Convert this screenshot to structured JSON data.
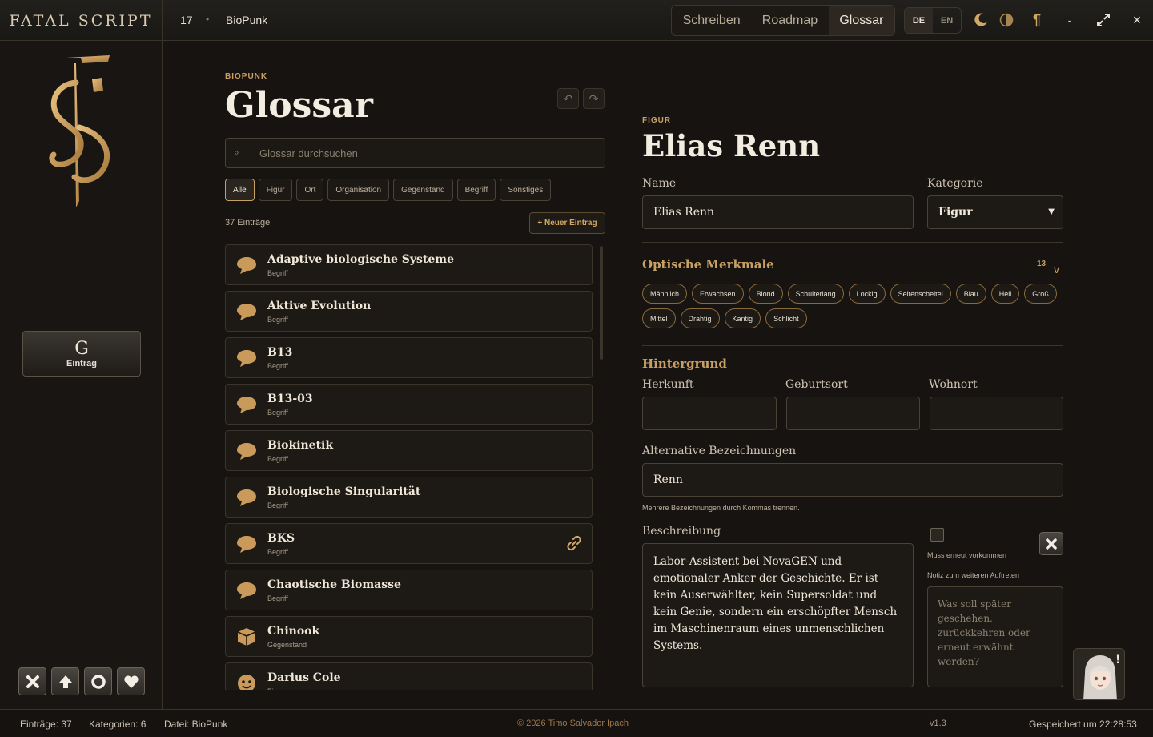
{
  "app": {
    "brand": "FATAL SCRIPT",
    "project_number": "17",
    "project_separator": "•",
    "project_name": "BioPunk"
  },
  "nav": {
    "tabs": [
      "Schreiben",
      "Roadmap",
      "Glossar"
    ],
    "active_tab": "Glossar",
    "languages": [
      "DE",
      "EN"
    ],
    "active_language": "DE",
    "window_icons": [
      "moon-icon",
      "theme-toggle-icon",
      "paragraph-icon",
      "minimize-icon",
      "maximize-icon",
      "close-icon"
    ],
    "minimize": "-",
    "close": "×"
  },
  "sidebar": {
    "logo": "FS monogram",
    "entry_button": {
      "letter": "G",
      "label": "Eintrag"
    },
    "bottom_icons": [
      "close-icon",
      "upload-arrow-icon",
      "record-icon",
      "heart-icon"
    ]
  },
  "glossary": {
    "eyebrow": "BIOPUNK",
    "title": "Glossar",
    "search_placeholder": "Glossar durchsuchen",
    "filters": [
      "Alle",
      "Figur",
      "Ort",
      "Organisation",
      "Gegenstand",
      "Begriff",
      "Sonstiges"
    ],
    "active_filter": "Alle",
    "count_label": "37 Einträge",
    "new_button": "+ Neuer Eintrag",
    "entries": [
      {
        "title": "Adaptive biologische Systeme",
        "type": "Begriff",
        "icon": "speech-bubble-icon"
      },
      {
        "title": "Aktive Evolution",
        "type": "Begriff",
        "icon": "speech-bubble-icon"
      },
      {
        "title": "B13",
        "type": "Begriff",
        "icon": "speech-bubble-icon"
      },
      {
        "title": "B13-03",
        "type": "Begriff",
        "icon": "speech-bubble-icon"
      },
      {
        "title": "Biokinetik",
        "type": "Begriff",
        "icon": "speech-bubble-icon"
      },
      {
        "title": "Biologische Singularität",
        "type": "Begriff",
        "icon": "speech-bubble-icon"
      },
      {
        "title": "BKS",
        "type": "Begriff",
        "icon": "speech-bubble-icon",
        "linked": true
      },
      {
        "title": "Chaotische Biomasse",
        "type": "Begriff",
        "icon": "speech-bubble-icon"
      },
      {
        "title": "Chinook",
        "type": "Gegenstand",
        "icon": "box-icon"
      },
      {
        "title": "Darius Cole",
        "type": "Figur",
        "icon": "face-icon"
      }
    ]
  },
  "detail": {
    "eyebrow": "FIGUR",
    "title": "Elias Renn",
    "name_label": "Name",
    "name_value": "Elias Renn",
    "category_label": "Kategorie",
    "category_value": "Figur",
    "visual_section": "Optische Merkmale",
    "visual_count": "13",
    "visual_toggle": "v",
    "tags": [
      "Männlich",
      "Erwachsen",
      "Blond",
      "Schulterlang",
      "Lockig",
      "Seitenscheitel",
      "Blau",
      "Hell",
      "Groß",
      "Mittel",
      "Drahtig",
      "Kantig",
      "Schlicht"
    ],
    "background_section": "Hintergrund",
    "origin_label": "Herkunft",
    "origin_value": "",
    "birthplace_label": "Geburtsort",
    "birthplace_value": "",
    "residence_label": "Wohnort",
    "residence_value": "",
    "aliases_label": "Alternative Bezeichnungen",
    "aliases_value": "Renn",
    "aliases_hint": "Mehrere Bezeichnungen durch Kommas trennen.",
    "description_label": "Beschreibung",
    "description_value": "Labor-Assistent bei NovaGEN und emotionaler Anker der Geschichte. Er ist kein Auserwählter, kein Supersoldat und kein Genie, sondern ein erschöpfter Mensch im Maschinenraum eines unmenschlichen Systems.",
    "recur_label": "Muss erneut vorkommen",
    "recur_checked": false,
    "note_label": "Notiz zum weiteren Auftreten",
    "note_placeholder": "Was soll später geschehen, zurückkehren oder erneut erwähnt werden?"
  },
  "status": {
    "entries": "Einträge: 37",
    "categories": "Kategorien: 6",
    "file": "Datei: BioPunk",
    "copyright": "© 2026 Timo Salvador Ipach",
    "version": "v1.3",
    "saved": "Gespeichert um 22:28:53"
  },
  "colors": {
    "accent": "#c8a064",
    "background": "#161310",
    "panel": "#1d1a16",
    "border": "#4a4236",
    "text": "#f0e7d8"
  }
}
